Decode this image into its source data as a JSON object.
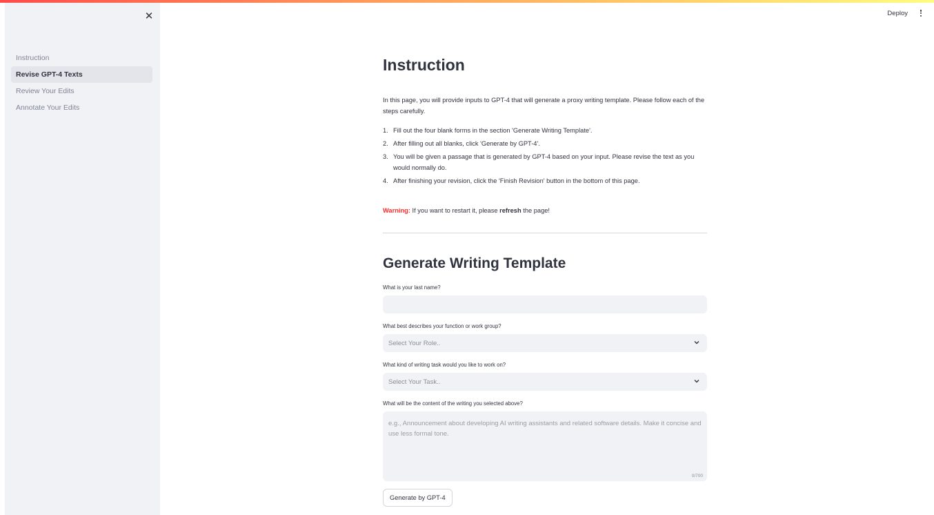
{
  "header": {
    "deploy_label": "Deploy"
  },
  "sidebar": {
    "close_icon": "close-icon",
    "items": [
      {
        "label": "Instruction",
        "active": false
      },
      {
        "label": "Revise GPT-4 Texts",
        "active": true
      },
      {
        "label": "Review Your Edits",
        "active": false
      },
      {
        "label": "Annotate Your Edits",
        "active": false
      }
    ]
  },
  "main": {
    "title": "Instruction",
    "intro": "In this page, you will provide inputs to GPT-4 that will generate a proxy writing template. Please follow each of the steps carefully.",
    "steps": [
      {
        "num": "1.",
        "text": "Fill out the four blank forms in the section 'Generate Writing Template'."
      },
      {
        "num": "2.",
        "text": "After filling out all blanks, click 'Generate by GPT-4'."
      },
      {
        "num": "3.",
        "text": "You will be given a passage that is generated by GPT-4 based on your input. Please revise the text as you would normally do."
      },
      {
        "num": "4.",
        "text": "After finishing your revision, click the 'Finish Revision' button in the bottom of this page."
      }
    ],
    "warning": {
      "label": "Warning:",
      "text_before": " If you want to restart it, please ",
      "bold": "refresh",
      "text_after": " the page!"
    },
    "section_title": "Generate Writing Template",
    "form": {
      "last_name_label": "What is your last name?",
      "last_name_value": "",
      "role_label": "What best describes your function or work group?",
      "role_placeholder": "Select Your Role..",
      "task_label": "What kind of writing task would you like to work on?",
      "task_placeholder": "Select Your Task..",
      "content_label": "What will be the content of the writing you selected above?",
      "content_placeholder": "e.g., Announcement about developing AI writing assistants and related software details. Make it concise and use less formal tone.",
      "content_counter": "0/700",
      "submit_label": "Generate by GPT-4"
    }
  },
  "colors": {
    "accent": "#ff4b4b",
    "warning": "#ff2b2b",
    "sidebar_bg": "#f0f2f6"
  }
}
